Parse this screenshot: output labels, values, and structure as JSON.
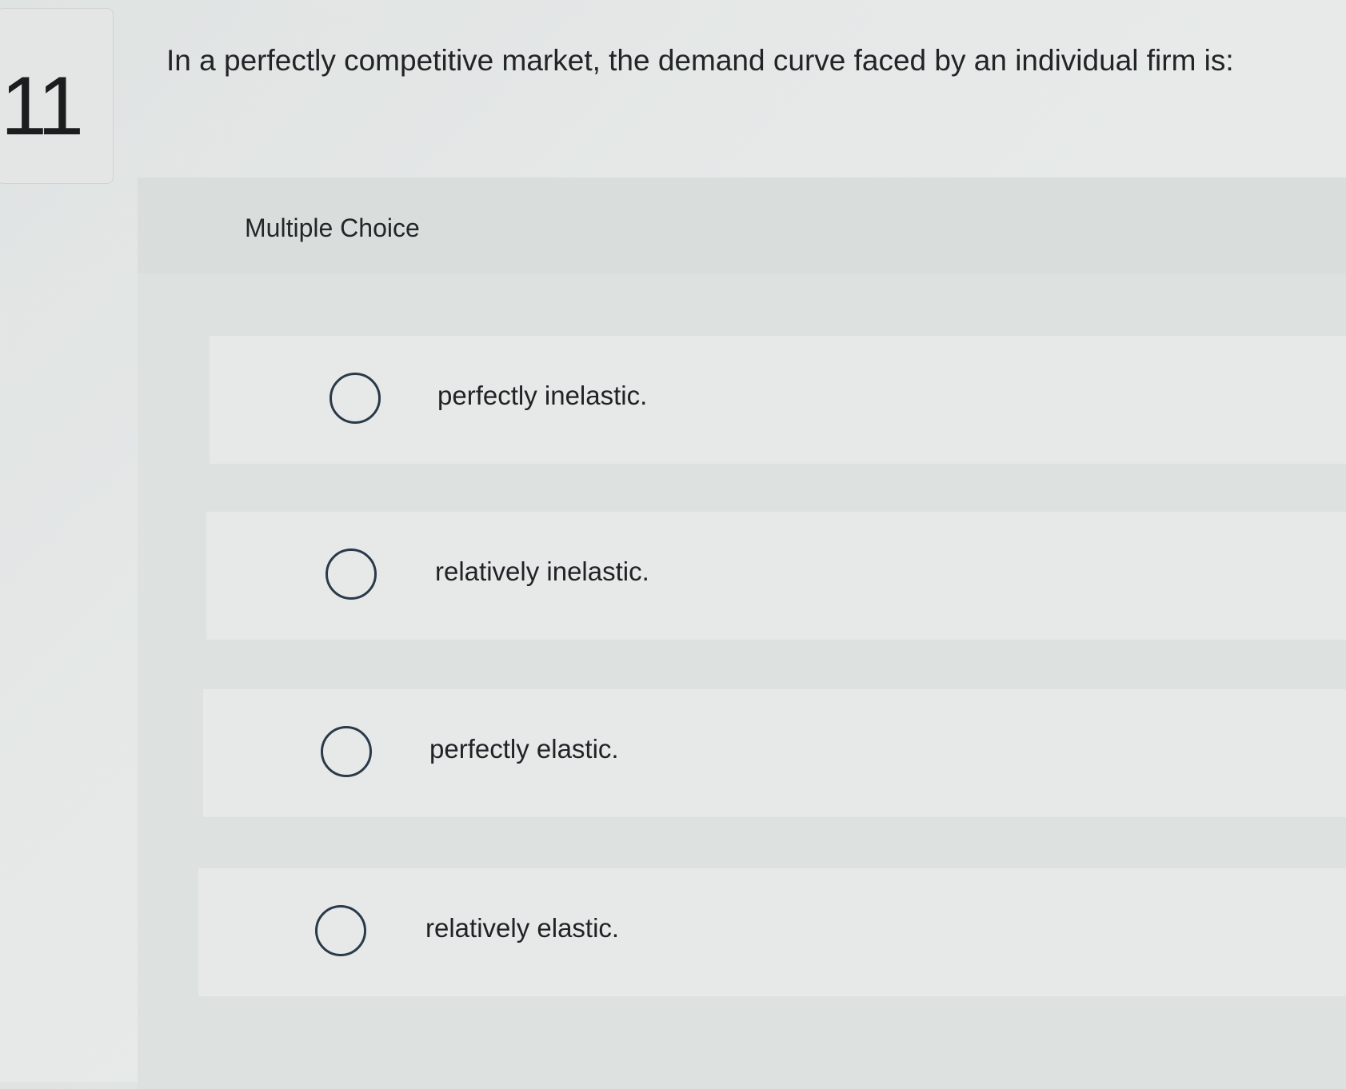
{
  "question": {
    "number": "11",
    "text": "In a perfectly competitive market, the demand curve faced by an individual firm is:"
  },
  "answer_section": {
    "label": "Multiple Choice",
    "options": [
      {
        "label": "perfectly inelastic.",
        "selected": false
      },
      {
        "label": "relatively inelastic.",
        "selected": false
      },
      {
        "label": "perfectly elastic.",
        "selected": false
      },
      {
        "label": "relatively elastic.",
        "selected": false
      }
    ]
  },
  "colors": {
    "background": "#e6e9e8",
    "panel": "#dde1e0",
    "radio_border": "#2b3a4a",
    "text": "#202326"
  }
}
